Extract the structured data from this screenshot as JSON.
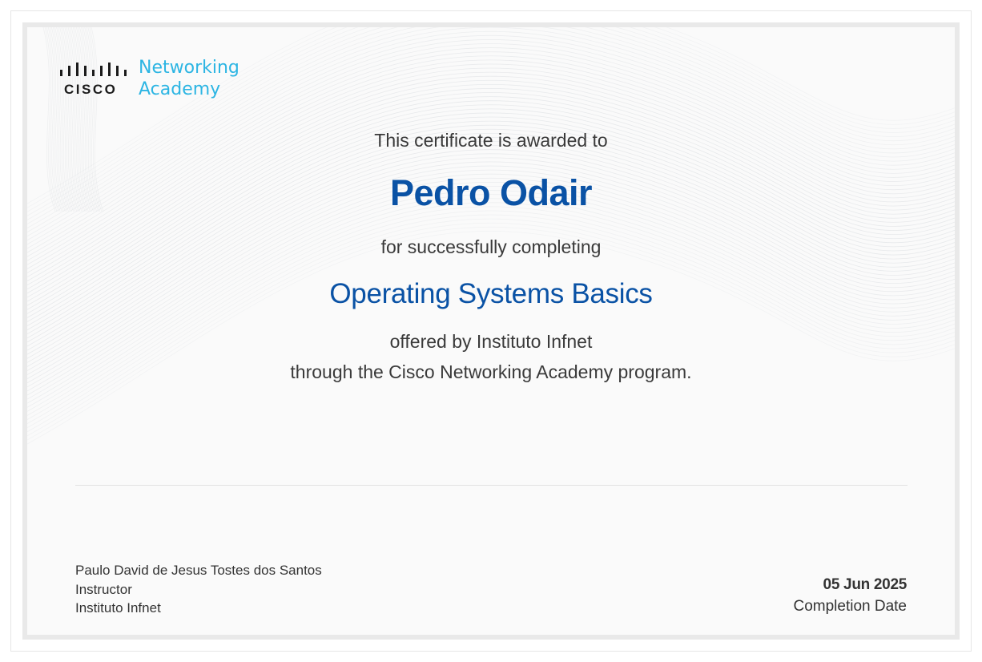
{
  "logo": {
    "brand": "CISCO",
    "line1": "Networking",
    "line2": "Academy",
    "brand_color": "#2cb5e3"
  },
  "certificate": {
    "awarded_text": "This certificate is awarded to",
    "recipient": "Pedro Odair",
    "completing_text": "for successfully completing",
    "course": "Operating Systems Basics",
    "offered_text": "offered by Instituto Infnet",
    "through_text": "through the Cisco Networking Academy program.",
    "accent_color": "#0a52a5"
  },
  "signatory": {
    "name": "Paulo David de Jesus Tostes dos Santos",
    "role": "Instructor",
    "organization": "Instituto Infnet"
  },
  "completion": {
    "date": "05 Jun 2025",
    "label": "Completion Date"
  }
}
